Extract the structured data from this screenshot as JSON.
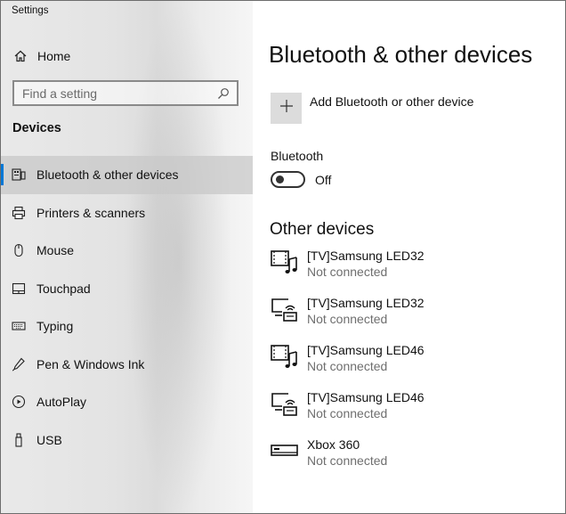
{
  "window": {
    "title": "Settings"
  },
  "sidebar": {
    "home_label": "Home",
    "search_placeholder": "Find a setting",
    "section_title": "Devices",
    "items": [
      {
        "label": "Bluetooth & other devices",
        "icon": "bluetooth-devices-icon",
        "selected": true
      },
      {
        "label": "Printers & scanners",
        "icon": "printer-icon",
        "selected": false
      },
      {
        "label": "Mouse",
        "icon": "mouse-icon",
        "selected": false
      },
      {
        "label": "Touchpad",
        "icon": "touchpad-icon",
        "selected": false
      },
      {
        "label": "Typing",
        "icon": "keyboard-icon",
        "selected": false
      },
      {
        "label": "Pen & Windows Ink",
        "icon": "pen-icon",
        "selected": false
      },
      {
        "label": "AutoPlay",
        "icon": "autoplay-icon",
        "selected": false
      },
      {
        "label": "USB",
        "icon": "usb-icon",
        "selected": false
      }
    ]
  },
  "main": {
    "title": "Bluetooth & other devices",
    "add_device_label": "Add Bluetooth or other device",
    "bluetooth": {
      "label": "Bluetooth",
      "state": "Off",
      "enabled": false
    },
    "other_devices_title": "Other devices",
    "devices": [
      {
        "name": "[TV]Samsung LED32",
        "status": "Not connected",
        "icon": "media-device-icon"
      },
      {
        "name": "[TV]Samsung LED32",
        "status": "Not connected",
        "icon": "wireless-display-icon"
      },
      {
        "name": "[TV]Samsung LED46",
        "status": "Not connected",
        "icon": "media-device-icon"
      },
      {
        "name": "[TV]Samsung LED46",
        "status": "Not connected",
        "icon": "wireless-display-icon"
      },
      {
        "name": "Xbox 360",
        "status": "Not connected",
        "icon": "game-console-icon"
      }
    ]
  },
  "colors": {
    "accent": "#0078d7",
    "sidebar_bg": "#e6e6e6",
    "selected_bg": "#cfcfcf",
    "secondary_text": "#6e6e6e"
  }
}
